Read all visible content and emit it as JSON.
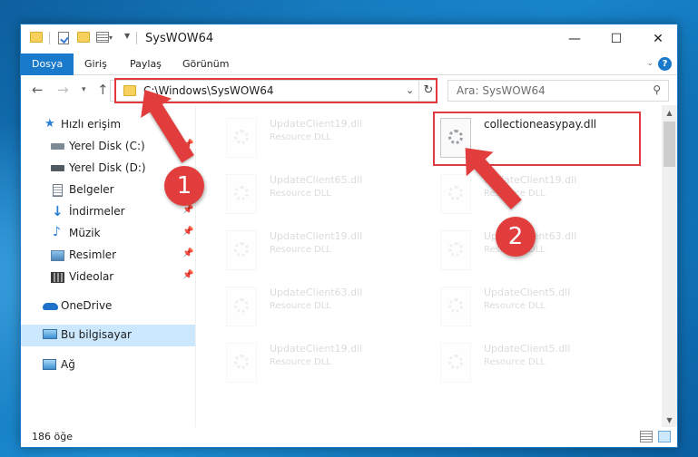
{
  "window": {
    "title": "SysWOW64",
    "controls": {
      "minimize": "—",
      "maximize": "☐",
      "close": "✕"
    }
  },
  "ribbon": {
    "tabs": [
      {
        "label": "Dosya",
        "active": true
      },
      {
        "label": "Giriş"
      },
      {
        "label": "Paylaş"
      },
      {
        "label": "Görünüm"
      }
    ],
    "help": "?"
  },
  "nav": {
    "path": "C:\\Windows\\SysWOW64",
    "search_placeholder": "Ara: SysWOW64"
  },
  "sidebar": {
    "items": [
      {
        "label": "Hızlı erişim",
        "icon": "star-icon"
      },
      {
        "label": "Yerel Disk (C:)",
        "icon": "drive-icon",
        "pinned": true
      },
      {
        "label": "Yerel Disk (D:)",
        "icon": "drive-icon"
      },
      {
        "label": "Belgeler",
        "icon": "documents-icon"
      },
      {
        "label": "İndirmeler",
        "icon": "download-icon",
        "pinned": true
      },
      {
        "label": "Müzik",
        "icon": "music-icon",
        "pinned": true
      },
      {
        "label": "Resimler",
        "icon": "pictures-icon",
        "pinned": true
      },
      {
        "label": "Videolar",
        "icon": "videos-icon",
        "pinned": true
      },
      {
        "label": "OneDrive",
        "icon": "onedrive-icon"
      },
      {
        "label": "Bu bilgisayar",
        "icon": "computer-icon",
        "selected": true
      },
      {
        "label": "Ağ",
        "icon": "network-icon"
      }
    ]
  },
  "files": [
    {
      "name": "UpdateClient19.dll",
      "type": "Resource DLL"
    },
    {
      "name": "collectioneasypay.dll",
      "type": "",
      "highlighted": true
    },
    {
      "name": "UpdateClient65.dll",
      "type": "Resource DLL"
    },
    {
      "name": "UpdateClient19.dll",
      "type": "Resource DLL"
    },
    {
      "name": "UpdateClient19.dll",
      "type": "Resource DLL"
    },
    {
      "name": "UpdateClient63.dll",
      "type": "Resource DLL"
    },
    {
      "name": "UpdateClient63.dll",
      "type": "Resource DLL"
    },
    {
      "name": "UpdateClient5.dll",
      "type": "Resource DLL"
    },
    {
      "name": "UpdateClient19.dll",
      "type": "Resource DLL"
    },
    {
      "name": "UpdateClient5.dll",
      "type": "Resource DLL"
    }
  ],
  "status": {
    "item_count": "186 öğe"
  },
  "annotations": {
    "step1": "1",
    "step2": "2",
    "color": "#e23d3d"
  }
}
